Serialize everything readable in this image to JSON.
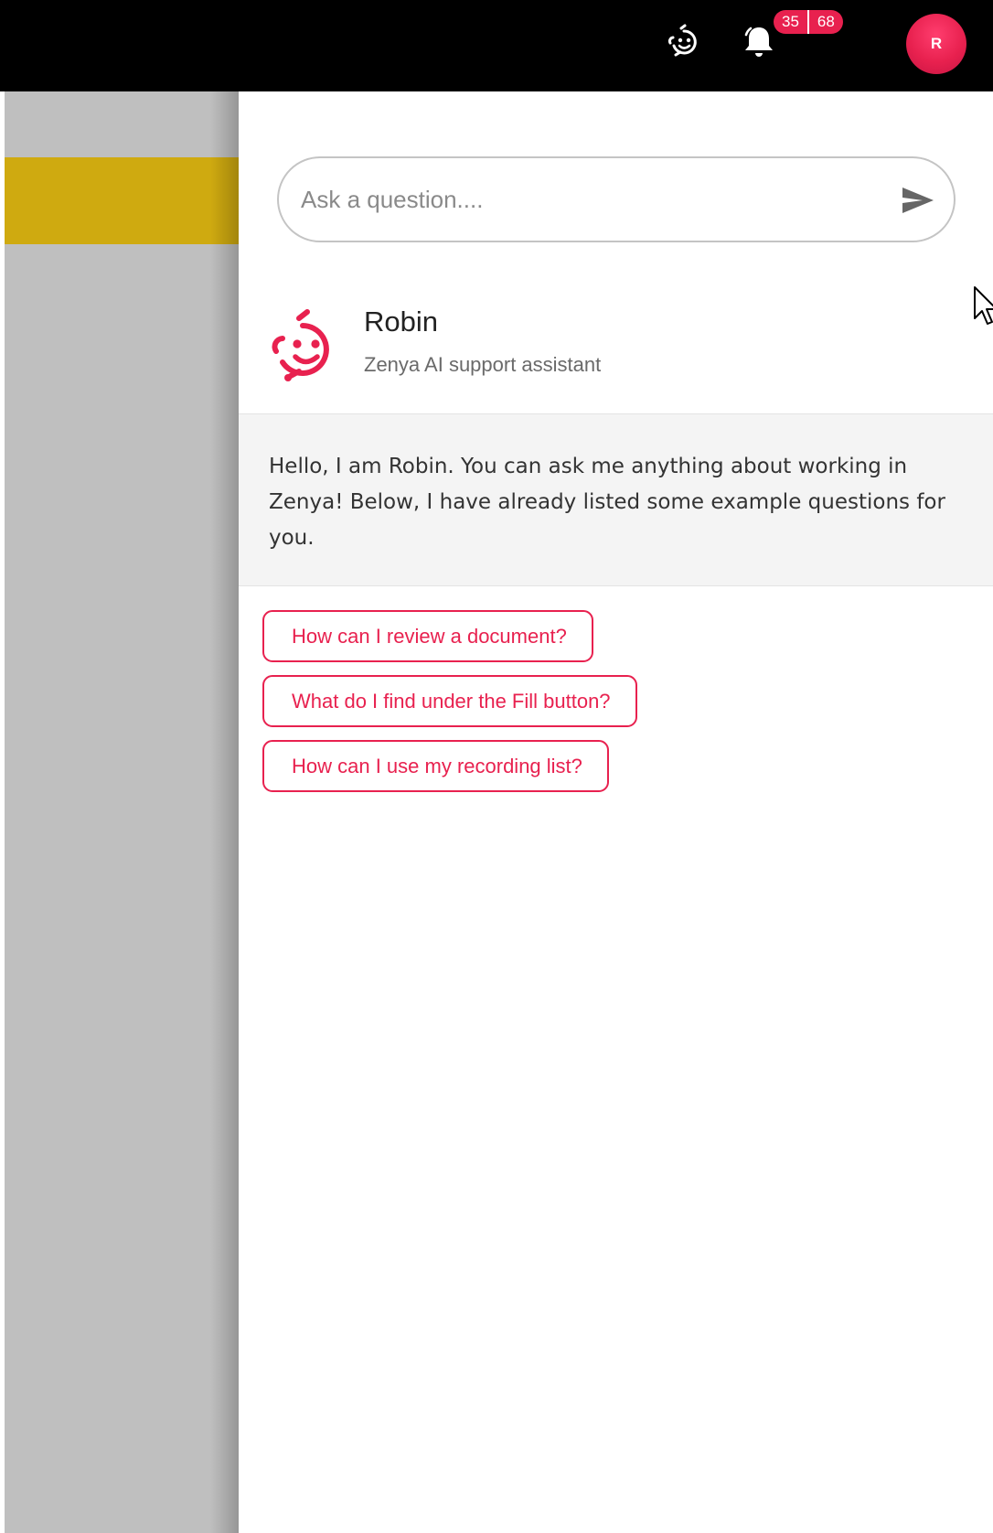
{
  "topbar": {
    "notification_counts": [
      "35",
      "68"
    ],
    "avatar_initial": "R",
    "icons": {
      "assistant": "assistant-face-icon",
      "notifications": "bell-icon"
    }
  },
  "chat": {
    "search": {
      "placeholder": "Ask a question....",
      "value": "",
      "send_icon": "send-icon"
    },
    "bot": {
      "name": "Robin",
      "subtitle": "Zenya AI support assistant",
      "icon": "robin-assistant-icon"
    },
    "intro_message": "Hello, I am Robin. You can ask me anything about working in Zenya! Below, I have already listed some example questions for you.",
    "suggestions": [
      "How can I review a document?",
      "What do I find under the Fill button?",
      "How can I use my recording list?"
    ]
  },
  "colors": {
    "accent": "#e8214f",
    "topbar_bg": "#000000",
    "backdrop": "#bfbfbf",
    "highlight": "#cfaa10",
    "intro_bg": "#f4f4f4"
  }
}
